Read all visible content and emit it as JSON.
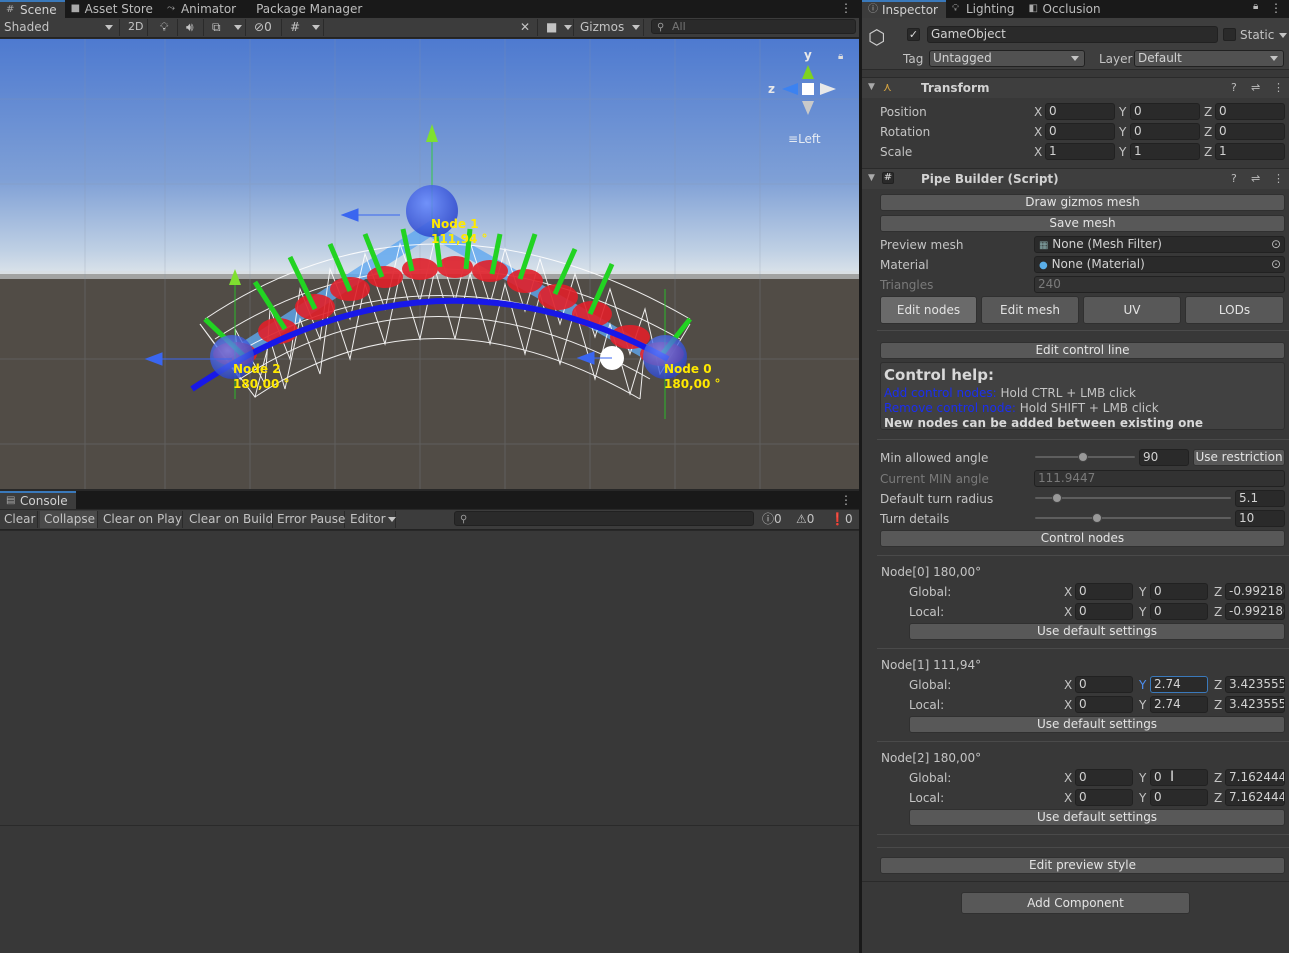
{
  "scene_tabs": {
    "scene": "Scene",
    "asset_store": "Asset Store",
    "animator": "Animator",
    "package_manager": "Package Manager"
  },
  "scene_toolbar": {
    "shading": "Shaded",
    "twod": "2D",
    "hidden_count": "0",
    "gizmos": "Gizmos",
    "search_placeholder": "All"
  },
  "scene_view": {
    "axis_y": "y",
    "axis_z": "z",
    "view_label": "Left",
    "node1_name": "Node 1",
    "node1_angle": "111,94 °",
    "node2_name": "Node 2",
    "node2_angle": "180,00 °",
    "node0_name": "Node 0",
    "node0_angle": "180,00 °"
  },
  "console": {
    "tab": "Console",
    "buttons": {
      "clear": "Clear",
      "collapse": "Collapse",
      "clear_on_play": "Clear on Play",
      "clear_on_build": "Clear on Build",
      "error_pause": "Error Pause",
      "editor": "Editor"
    },
    "counts": {
      "info": "0",
      "warn": "0",
      "error": "0"
    }
  },
  "inspector_tabs": {
    "inspector": "Inspector",
    "lighting": "Lighting",
    "occlusion": "Occlusion"
  },
  "gameobject": {
    "name": "GameObject",
    "static": "Static",
    "tag_label": "Tag",
    "tag": "Untagged",
    "layer_label": "Layer",
    "layer": "Default"
  },
  "transform": {
    "title": "Transform",
    "position_label": "Position",
    "rotation_label": "Rotation",
    "scale_label": "Scale",
    "pos": {
      "x": "0",
      "y": "0",
      "z": "0"
    },
    "rot": {
      "x": "0",
      "y": "0",
      "z": "0"
    },
    "scl": {
      "x": "1",
      "y": "1",
      "z": "1"
    }
  },
  "pipe_builder": {
    "title": "Pipe Builder (Script)",
    "draw_gizmos": "Draw gizmos mesh",
    "save_mesh": "Save mesh",
    "preview_mesh_label": "Preview mesh",
    "preview_mesh": "None (Mesh Filter)",
    "material_label": "Material",
    "material": "None (Material)",
    "triangles_label": "Triangles",
    "triangles": "240",
    "tabs": {
      "edit_nodes": "Edit nodes",
      "edit_mesh": "Edit mesh",
      "uv": "UV",
      "lods": "LODs"
    },
    "edit_control_line": "Edit control line",
    "help_title": "Control help:",
    "help_add_key": "Add control nodes:",
    "help_add_val": "Hold CTRL + LMB click",
    "help_remove_key": "Remove control node:",
    "help_remove_val": "Hold SHIFT + LMB click",
    "help_note": "New nodes can be added between existing one",
    "min_angle_label": "Min allowed angle",
    "min_angle": "90",
    "use_restriction": "Use restriction",
    "current_min_label": "Current MIN angle",
    "current_min": "111.9447",
    "turn_radius_label": "Default turn radius",
    "turn_radius": "5.1",
    "turn_details_label": "Turn details",
    "turn_details": "10",
    "control_nodes": "Control nodes",
    "global_label": "Global:",
    "local_label": "Local:",
    "use_default": "Use default settings",
    "nodes": [
      {
        "title": "Node[0] 180,00°",
        "gx": "0",
        "gy": "0",
        "gz": "-0.992180",
        "lx": "0",
        "ly": "0",
        "lz": "-0.992180"
      },
      {
        "title": "Node[1] 111,94°",
        "gx": "0",
        "gy": "2.74",
        "gz": "3.423555",
        "lx": "0",
        "ly": "2.74",
        "lz": "3.423555"
      },
      {
        "title": "Node[2] 180,00°",
        "gx": "0",
        "gy": "0",
        "gz": "7.162444",
        "lx": "0",
        "ly": "0",
        "lz": "7.162444"
      }
    ],
    "edit_preview_style": "Edit preview style"
  },
  "add_component": "Add Component"
}
